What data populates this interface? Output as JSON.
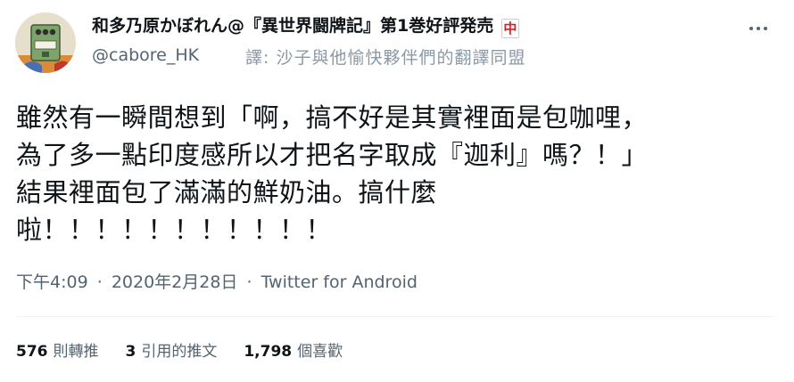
{
  "author": {
    "display_name": "和多乃原かぼれん@『異世界闘牌記』第1巻好評発売",
    "badge": "中",
    "handle": "@cabore_HK",
    "avatar_icon": "avatar-image"
  },
  "translated_by": "譯: 沙子與他愉快夥伴們的翻譯同盟",
  "more_icon": "more-horizontal-icon",
  "tweet": {
    "lines": [
      "雖然有一瞬間想到「啊，搞不好是其實裡面是包咖哩，",
      "為了多一點印度感所以才把名字取成『迦利』嗎？！」",
      "結果裡面包了滿滿的鮮奶油。搞什麼",
      "啦！！！！！！！！！！！"
    ]
  },
  "meta": {
    "time": "下午4:09",
    "separator": "·",
    "date": "2020年2月28日",
    "source": "Twitter for Android"
  },
  "stats": {
    "retweets": {
      "count": "576",
      "label": "則轉推"
    },
    "quotes": {
      "count": "3",
      "label": "引用的推文"
    },
    "likes": {
      "count": "1,798",
      "label": "個喜歡"
    }
  },
  "colors": {
    "primary_text": "#0f1419",
    "secondary_text": "#536471",
    "badge_red": "#d3202a"
  }
}
